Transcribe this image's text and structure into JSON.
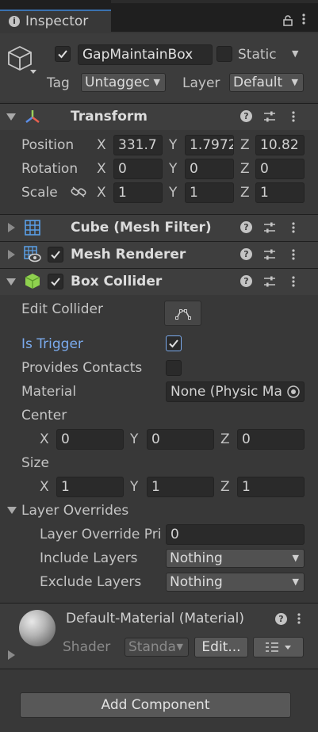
{
  "tab": {
    "title": "Inspector",
    "icon": "info-icon"
  },
  "gameobject": {
    "active": true,
    "name": "GapMaintainBox",
    "static_label": "Static",
    "static_checked": false,
    "tag_label": "Tag",
    "tag_value": "Untaggec",
    "layer_label": "Layer",
    "layer_value": "Default"
  },
  "transform": {
    "title": "Transform",
    "position": {
      "label": "Position",
      "x": "331.7",
      "y": "1.7972",
      "z": "10.82"
    },
    "rotation": {
      "label": "Rotation",
      "x": "0",
      "y": "0",
      "z": "0"
    },
    "scale": {
      "label": "Scale",
      "x": "1",
      "y": "1",
      "z": "1"
    }
  },
  "axes": {
    "x": "X",
    "y": "Y",
    "z": "Z"
  },
  "mesh_filter": {
    "title": "Cube (Mesh Filter)"
  },
  "mesh_renderer": {
    "title": "Mesh Renderer",
    "enabled": true
  },
  "box_collider": {
    "title": "Box Collider",
    "enabled": true,
    "edit_collider_label": "Edit Collider",
    "is_trigger_label": "Is Trigger",
    "is_trigger": true,
    "provides_contacts_label": "Provides Contacts",
    "provides_contacts": false,
    "material_label": "Material",
    "material_value": "None (Physic Ma",
    "center_label": "Center",
    "center": {
      "x": "0",
      "y": "0",
      "z": "0"
    },
    "size_label": "Size",
    "size": {
      "x": "1",
      "y": "1",
      "z": "1"
    },
    "layer_overrides_label": "Layer Overrides",
    "layer_override_priority_label": "Layer Override Pri",
    "layer_override_priority": "0",
    "include_layers_label": "Include Layers",
    "include_layers_value": "Nothing",
    "exclude_layers_label": "Exclude Layers",
    "exclude_layers_value": "Nothing"
  },
  "material": {
    "title": "Default-Material (Material)",
    "shader_label": "Shader",
    "shader_value": "Standa",
    "edit_label": "Edit..."
  },
  "add_component_label": "Add Component",
  "colors": {
    "accent_blue": "#7babee",
    "background": "#383838",
    "header": "#3e3e3e"
  }
}
